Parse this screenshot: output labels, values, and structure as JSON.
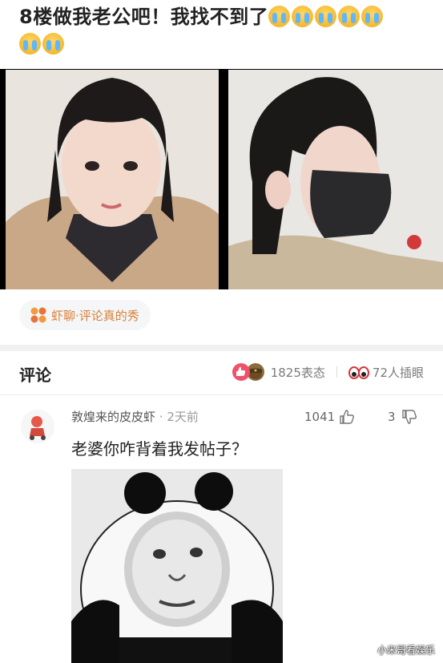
{
  "post": {
    "title": "8楼做我老公吧！我找不到了",
    "emoji": "crying-face-icon"
  },
  "topic": {
    "icon": "shrimp-logo-icon",
    "label": "虾聊·评论真的秀"
  },
  "comments_header": {
    "title": "评论",
    "reaction_count": "1825表态",
    "viewer_count": "72人插眼"
  },
  "comment": {
    "username": "敦煌来的皮皮虾",
    "time_ago": " · 2天前",
    "likes": "1041",
    "dislikes": "3",
    "text": "老婆你咋背着我发帖子？"
  },
  "watermark": "小米哥看娱乐",
  "colors": {
    "accent_orange": "#e58a3c",
    "like_red": "#f0526a"
  }
}
